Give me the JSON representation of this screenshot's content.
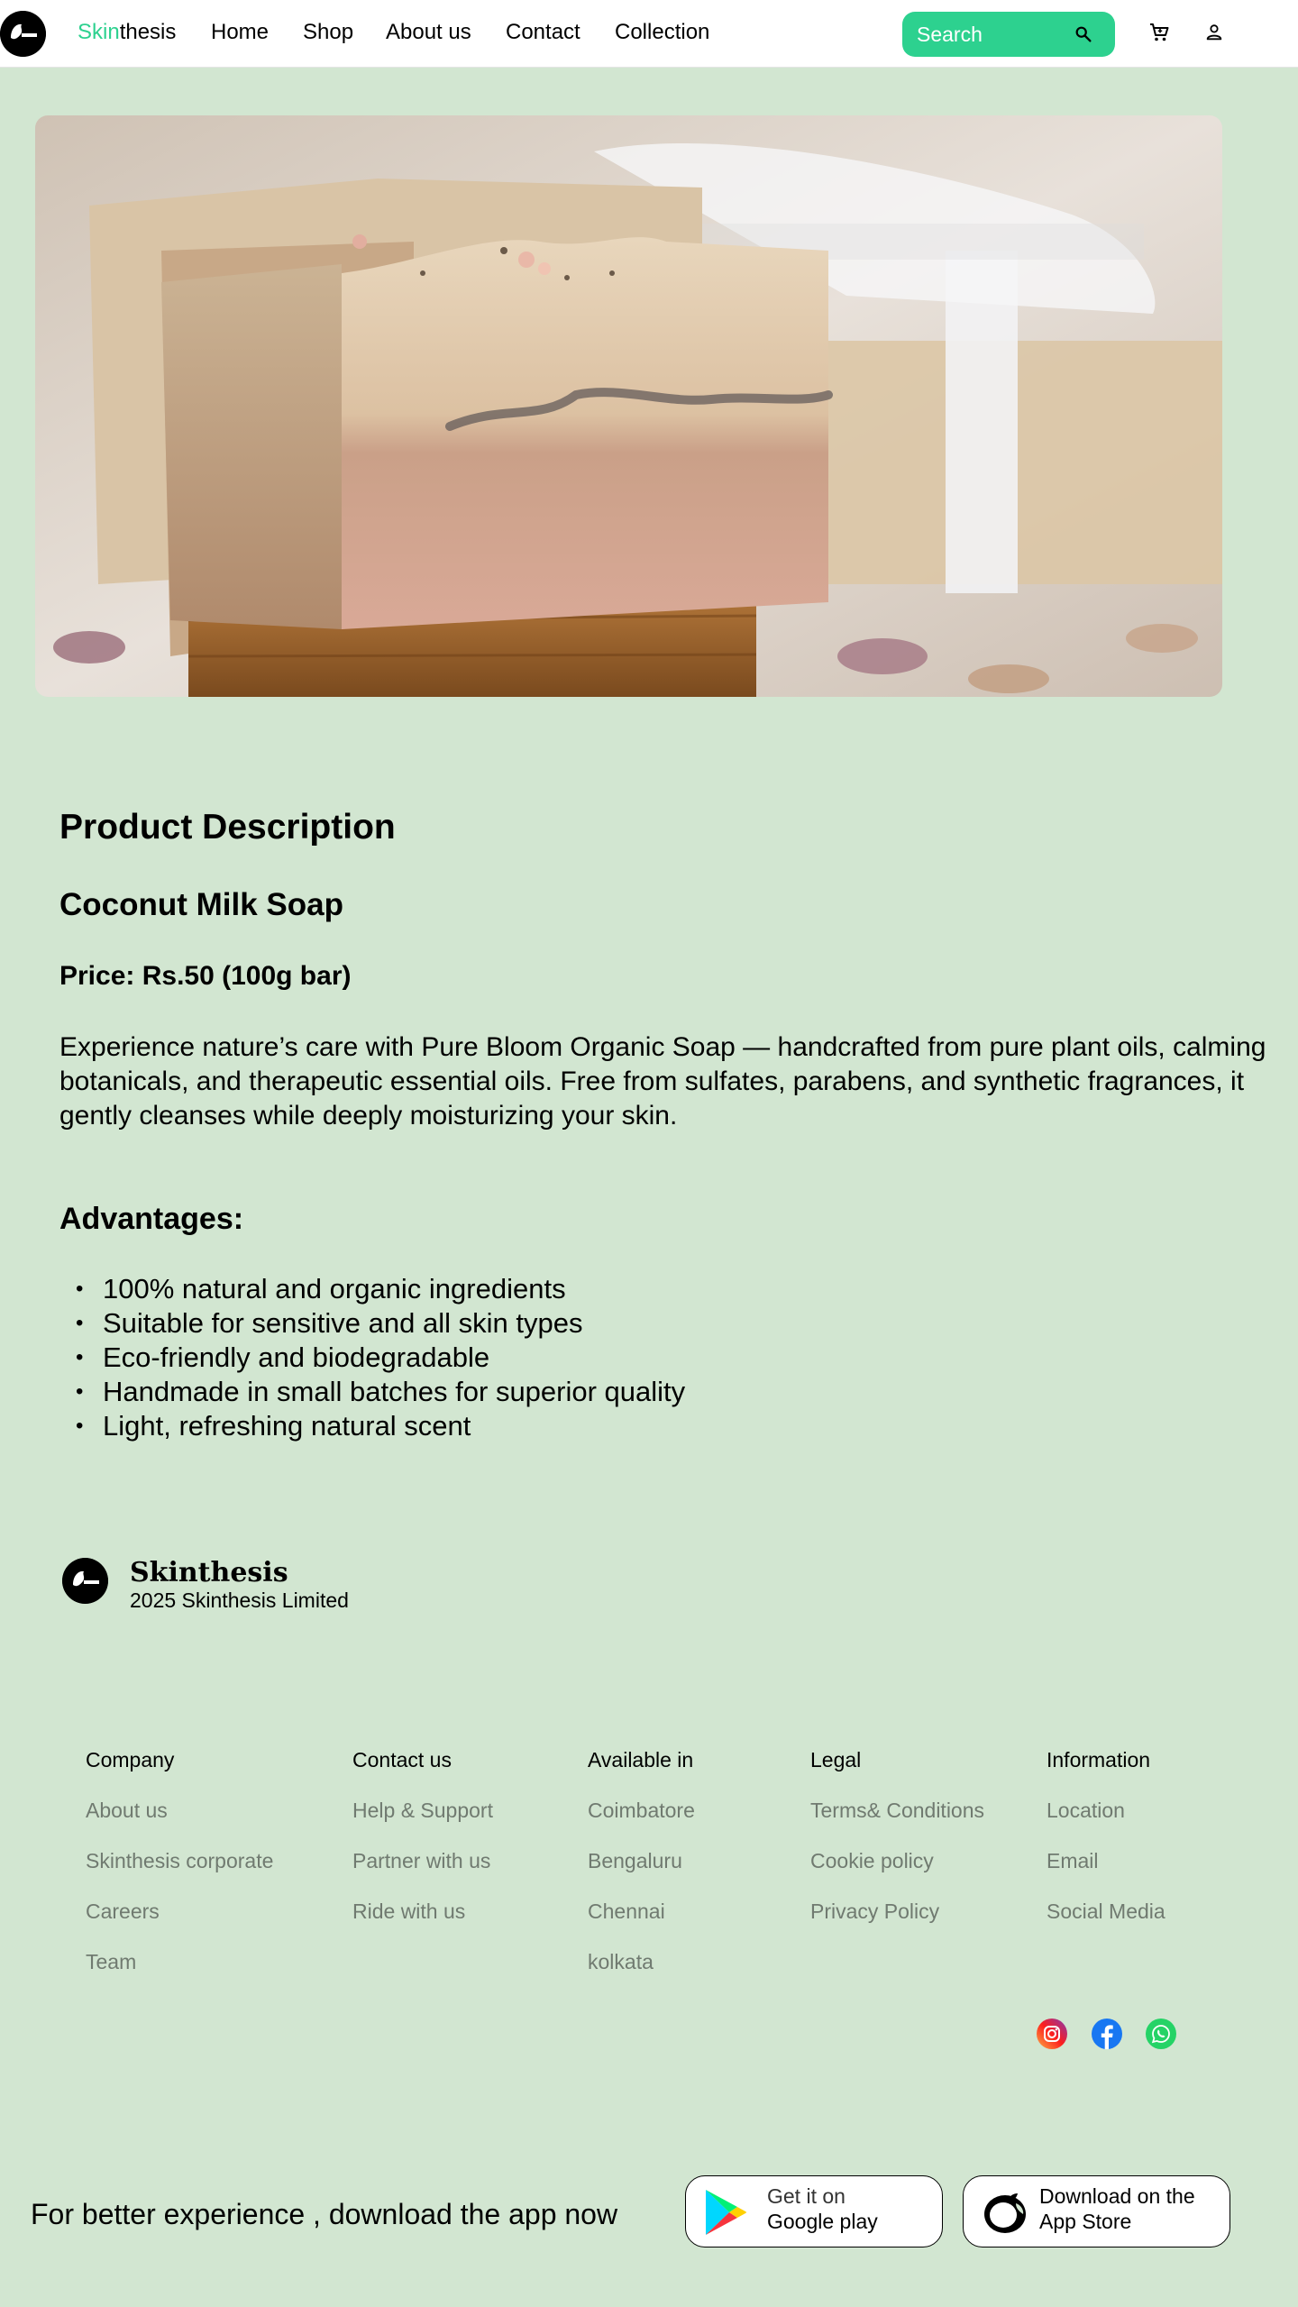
{
  "header": {
    "brand_accent": "Skin",
    "brand_rest": "thesis",
    "nav": [
      "Home",
      "Shop",
      "About us",
      "Contact",
      "Collection"
    ],
    "search_placeholder": "Search",
    "accent_color": "#2dd18f"
  },
  "hero": {
    "image": "soap-bars-photo"
  },
  "product": {
    "section_title": "Product Description",
    "name": "Coconut Milk Soap",
    "price": "Price: Rs.50 (100g bar)",
    "description": "Experience nature’s care with Pure Bloom Organic Soap — handcrafted from pure plant oils, calming botanicals, and therapeutic essential oils. Free from sulfates, parabens, and synthetic fragrances, it gently cleanses while deeply moisturizing your skin.",
    "advantages_title": "Advantages:",
    "advantages": [
      "100% natural and organic ingredients",
      "Suitable for sensitive and all skin types",
      "Eco-friendly and biodegradable",
      "Handmade in small batches for superior quality",
      "Light, refreshing natural scent"
    ]
  },
  "footer": {
    "brand": "Skinthesis",
    "copyright": "2025 Skinthesis Limited",
    "columns": [
      {
        "title": "Company",
        "links": [
          "About us",
          "Skinthesis corporate",
          "Careers",
          "Team"
        ]
      },
      {
        "title": "Contact us",
        "links": [
          "Help & Support",
          "Partner with us",
          "Ride with us"
        ]
      },
      {
        "title": "Available in",
        "links": [
          "Coimbatore",
          "Bengaluru",
          "Chennai",
          "kolkata"
        ]
      },
      {
        "title": "Legal",
        "links": [
          "Terms& Conditions",
          "Cookie policy",
          "Privacy Policy"
        ]
      },
      {
        "title": "Information",
        "links": [
          "Location",
          "Email",
          "Social Media"
        ]
      }
    ],
    "social": [
      "instagram-icon",
      "facebook-icon",
      "whatsapp-icon"
    ]
  },
  "app_banner": {
    "text": "For better experience , download the app now",
    "google_line1": "Get it on",
    "google_line2": "Google play",
    "apple_line1": "Download on the",
    "apple_line2": "App Store"
  }
}
